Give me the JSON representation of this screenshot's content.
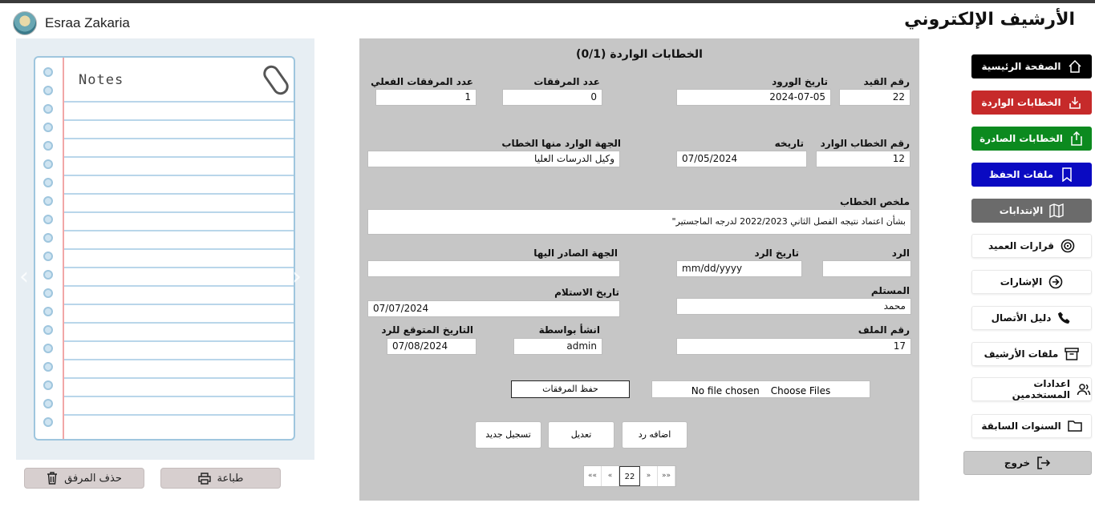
{
  "header": {
    "app_title": "الأرشيف الإلكتروني",
    "user_name": "Esraa Zakaria"
  },
  "preview": {
    "notebook_title": "Notes",
    "delete_attachment_label": "حذف المرفق",
    "print_label": "طباعة",
    "prev_arrow": "‹",
    "next_arrow": "›"
  },
  "form": {
    "title": "الخطابات الواردة (0/1)",
    "fields": {
      "record_no": {
        "label": "رقم القيد",
        "value": "22"
      },
      "arrival_date": {
        "label": "تاريخ الورود",
        "value": "2024-07-05"
      },
      "attachments_count": {
        "label": "عدد المرفقات",
        "value": "0"
      },
      "actual_attachments_count": {
        "label": "عدد المرفقات الفعلي",
        "value": "1"
      },
      "incoming_letter_no": {
        "label": "رقم الخطاب الوارد",
        "value": "12"
      },
      "letter_date": {
        "label": "تاريخه",
        "value": "07/05/2024"
      },
      "source_entity": {
        "label": "الجهة الوارد منها الخطاب",
        "value": "وكيل الدرسات العليا"
      },
      "summary": {
        "label": "ملخص الخطاب",
        "value": "بشأن اعتماد نتيجه الفصل الثاني 2022/2023 لدرجه الماجستير\""
      },
      "reply": {
        "label": "الرد",
        "value": ""
      },
      "reply_date": {
        "label": "تاريخ الرد",
        "value": "",
        "placeholder": "mm/dd/yyyy"
      },
      "issued_to": {
        "label": "الجهة الصادر اليها",
        "value": ""
      },
      "receiver": {
        "label": "المستلم",
        "value": "محمد"
      },
      "receipt_date": {
        "label": "تاريخ الاستلام",
        "value": "07/07/2024"
      },
      "file_no": {
        "label": "رقم الملف",
        "value": "17"
      },
      "created_by": {
        "label": "انشأ بواسطة",
        "value": "admin"
      },
      "expected_reply_date": {
        "label": "التاريخ المتوقع للرد",
        "value": "07/08/2024"
      }
    },
    "save_attachments_label": "حفظ المرفقات",
    "file_input": {
      "button_label": "Choose Files",
      "status": "No file chosen"
    },
    "actions": {
      "add_reply": "اضافه رد",
      "edit": "تعديل",
      "new_record": "تسجيل جديد"
    },
    "pager": {
      "first": "««",
      "prev": "«",
      "current": "22",
      "next": "»",
      "last": "»»"
    }
  },
  "sidebar": {
    "items": [
      {
        "label": "الصفحة الرئيسية",
        "icon": "home-icon",
        "color": "#000000"
      },
      {
        "label": "الخطابات الواردة",
        "icon": "download-icon",
        "color": "#c62a2a"
      },
      {
        "label": "الخطابات الصادرة",
        "icon": "upload-icon",
        "color": "#0c8a1f"
      },
      {
        "label": "ملفات الحفظ",
        "icon": "bookmark-icon",
        "color": "#0a0ac2"
      },
      {
        "label": "الإنتدابات",
        "icon": "map-icon",
        "color": "#6b6b6b"
      },
      {
        "label": "قرارات العميد",
        "icon": "target-icon"
      },
      {
        "label": "الإشارات",
        "icon": "arrow-circle-icon"
      },
      {
        "label": "دليل الأتصال",
        "icon": "phone-icon"
      },
      {
        "label": "ملفات الأرشيف",
        "icon": "archive-icon"
      },
      {
        "label": "اعدادات المستخدمين",
        "icon": "users-icon"
      },
      {
        "label": "السنوات السابقة",
        "icon": "folder-icon"
      }
    ],
    "logout_label": "خروج"
  }
}
